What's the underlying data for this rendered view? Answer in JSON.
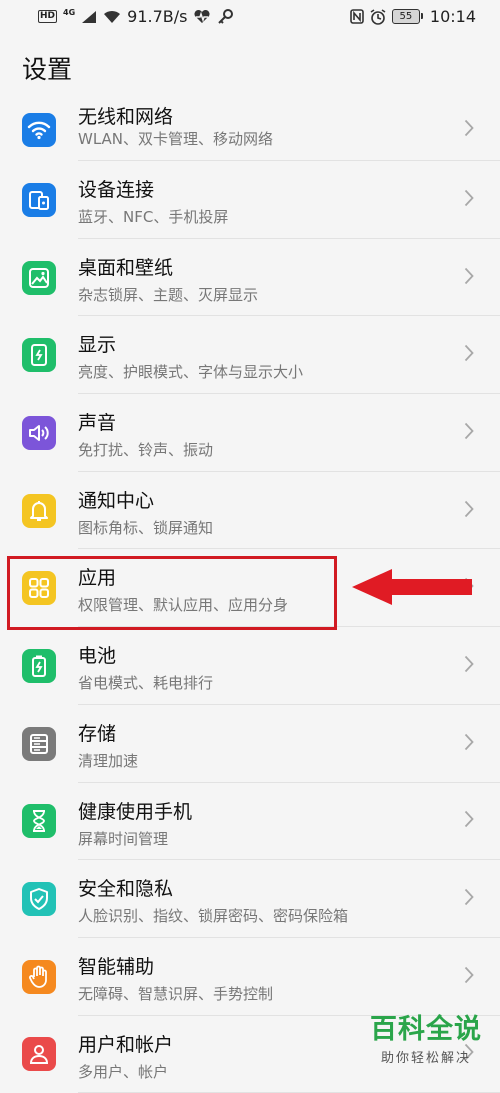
{
  "status_bar": {
    "hd": "HD",
    "net": "4G",
    "speed": "91.7B/s",
    "battery": "55",
    "time": "10:14"
  },
  "header": {
    "title": "设置"
  },
  "settings": [
    {
      "label": "无线和网络",
      "sub": "WLAN、双卡管理、移动网络",
      "color": "#1a7de6",
      "icon": "wifi-icon"
    },
    {
      "label": "设备连接",
      "sub": "蓝牙、NFC、手机投屏",
      "color": "#1a7de6",
      "icon": "device-connect-icon"
    },
    {
      "label": "桌面和壁纸",
      "sub": "杂志锁屏、主题、灭屏显示",
      "color": "#1fbe6a",
      "icon": "wallpaper-icon"
    },
    {
      "label": "显示",
      "sub": "亮度、护眼模式、字体与显示大小",
      "color": "#1fbe6a",
      "icon": "display-icon"
    },
    {
      "label": "声音",
      "sub": "免打扰、铃声、振动",
      "color": "#7c55d9",
      "icon": "sound-icon"
    },
    {
      "label": "通知中心",
      "sub": "图标角标、锁屏通知",
      "color": "#f4c522",
      "icon": "notification-bell-icon"
    },
    {
      "label": "应用",
      "sub": "权限管理、默认应用、应用分身",
      "color": "#f4c522",
      "icon": "apps-grid-icon"
    },
    {
      "label": "电池",
      "sub": "省电模式、耗电排行",
      "color": "#1fbe6a",
      "icon": "battery-icon"
    },
    {
      "label": "存储",
      "sub": "清理加速",
      "color": "#7a7a7a",
      "icon": "storage-icon"
    },
    {
      "label": "健康使用手机",
      "sub": "屏幕时间管理",
      "color": "#1fbe6a",
      "icon": "hourglass-icon"
    },
    {
      "label": "安全和隐私",
      "sub": "人脸识别、指纹、锁屏密码、密码保险箱",
      "color": "#22c2b6",
      "icon": "shield-icon"
    },
    {
      "label": "智能辅助",
      "sub": "无障碍、智慧识屏、手势控制",
      "color": "#f5891f",
      "icon": "hand-icon"
    },
    {
      "label": "用户和帐户",
      "sub": "多用户、帐户",
      "color": "#ea4a4a",
      "icon": "user-icon"
    }
  ],
  "watermark": {
    "main": "百科全说",
    "sub": "助你轻松解决"
  },
  "colors": {
    "highlight": "#d11a22",
    "watermark": "#2aa54a"
  }
}
